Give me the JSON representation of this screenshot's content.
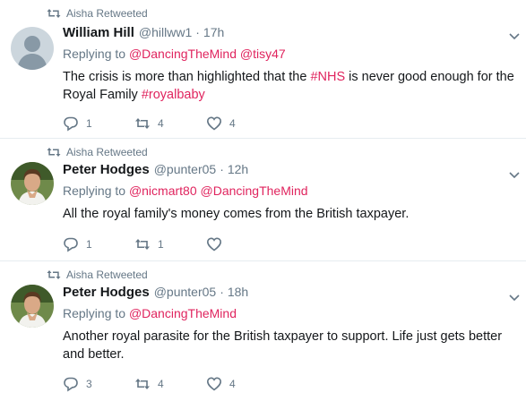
{
  "tweets": [
    {
      "retweeted_by": "Aisha Retweeted",
      "avatar": "default-avatar",
      "name": "William Hill",
      "handle": "@hillww1",
      "time": "17h",
      "replying_to": "Replying to",
      "mentions": [
        "@DancingTheMind",
        "@tisy47"
      ],
      "body_pre": "The crisis is more than highlighted that the ",
      "hashtag1": "#NHS",
      "body_mid": " is never good enough for the Royal Family ",
      "hashtag2": "#royalbaby",
      "replies": "1",
      "retweets": "4",
      "likes": "4"
    },
    {
      "retweeted_by": "Aisha Retweeted",
      "avatar": "user-photo",
      "name": "Peter Hodges",
      "handle": "@punter05",
      "time": "12h",
      "replying_to": "Replying to",
      "mentions": [
        "@nicmart80",
        "@DancingTheMind"
      ],
      "body": "All the royal family's money comes from the British taxpayer.",
      "replies": "1",
      "retweets": "1",
      "likes": ""
    },
    {
      "retweeted_by": "Aisha Retweeted",
      "avatar": "user-photo",
      "name": "Peter Hodges",
      "handle": "@punter05",
      "time": "18h",
      "replying_to": "Replying to",
      "mentions": [
        "@DancingTheMind"
      ],
      "body": "Another royal parasite for the British taxpayer to support. Life just gets better and better.",
      "replies": "3",
      "retweets": "4",
      "likes": "4"
    }
  ],
  "colors": {
    "accent": "#e0245e",
    "secondary_text": "#657786",
    "divider": "#e6ecf0"
  }
}
